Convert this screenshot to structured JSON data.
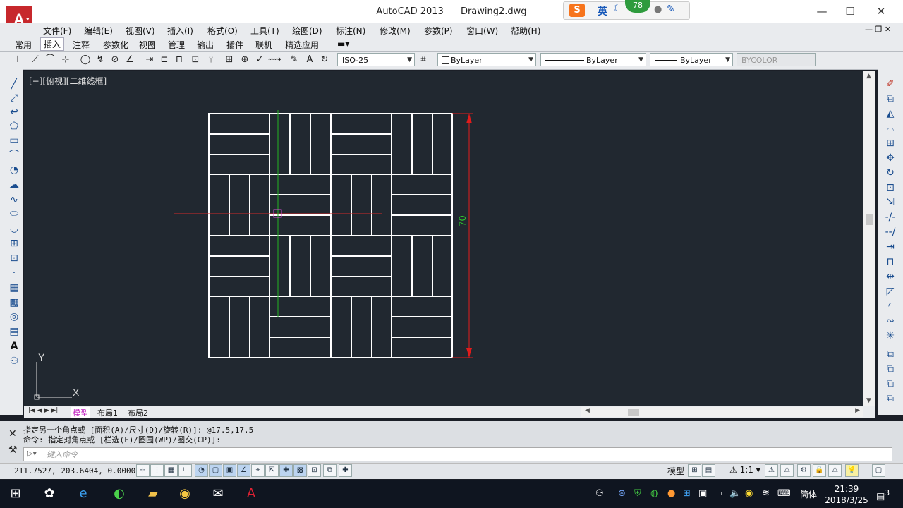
{
  "titlebar": {
    "app_name": "AutoCAD 2013",
    "doc_name": "Drawing2.dwg",
    "minimize": "—",
    "maximize": "☐",
    "close": "✕"
  },
  "ime": {
    "brand": "S",
    "lang": "英",
    "badge": "78"
  },
  "menu": [
    "文件(F)",
    "编辑(E)",
    "视图(V)",
    "插入(I)",
    "格式(O)",
    "工具(T)",
    "绘图(D)",
    "标注(N)",
    "修改(M)",
    "参数(P)",
    "窗口(W)",
    "帮助(H)"
  ],
  "ribbon_tabs": [
    "常用",
    "插入",
    "注释",
    "参数化",
    "视图",
    "管理",
    "输出",
    "插件",
    "联机",
    "精选应用"
  ],
  "active_tab": "插入",
  "toolbar": {
    "dimstyle": "ISO-25",
    "color": "ByLayer",
    "linetype": "ByLayer",
    "lineweight": "ByLayer",
    "plotstyle": "BYCOLOR"
  },
  "view_label": "[−][俯视][二维线框]",
  "dimension_text": "70",
  "ucs": {
    "x": "X",
    "y": "Y"
  },
  "layout_tabs": [
    "模型",
    "布局1",
    "布局2"
  ],
  "command": {
    "history_1": "指定另一个角点或 [面积(A)/尺寸(D)/旋转(R)]: @17.5,17.5",
    "history_2": "命令: 指定对角点或 [栏选(F)/圈围(WP)/圈交(CP)]:",
    "input_placeholder": "键入命令"
  },
  "status": {
    "coords": "211.7527, 203.6404, 0.0000",
    "model": "模型",
    "scale": "1:1"
  },
  "taskbar": {
    "time": "21:39",
    "date": "2018/3/25",
    "lang": "简体",
    "notif": "3"
  },
  "colors": {
    "canvas_bg": "#212830",
    "geometry": "#ffffff",
    "dimension": "#e21b1b",
    "dim_text": "#2fc72f",
    "crosshair_h": "#d12a2a",
    "crosshair_v": "#22b322",
    "active_layout": "#c020c0"
  }
}
